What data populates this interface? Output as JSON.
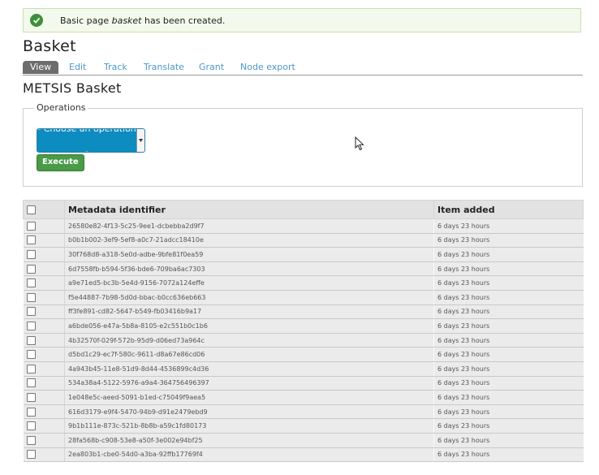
{
  "status": {
    "prefix": "Basic page ",
    "item": "basket",
    "suffix": " has been created."
  },
  "page_title": "Basket",
  "tabs": [
    {
      "label": "View",
      "active": true
    },
    {
      "label": "Edit"
    },
    {
      "label": "Track"
    },
    {
      "label": "Translate"
    },
    {
      "label": "Grant"
    },
    {
      "label": "Node export"
    }
  ],
  "subtitle": "METSIS Basket",
  "operations": {
    "legend": "Operations",
    "select_value": "- Choose an operation -",
    "execute_label": "Execute"
  },
  "table": {
    "columns": [
      "Metadata identifier",
      "Item added"
    ],
    "rows": [
      {
        "id": "26580e82-4f13-5c25-9ee1-dcbebba2d9f7",
        "added": "6 days 23 hours"
      },
      {
        "id": "b0b1b002-3ef9-5ef8-a0c7-21adcc18410e",
        "added": "6 days 23 hours"
      },
      {
        "id": "30f768d8-a318-5e0d-adbe-9bfe81f0ea59",
        "added": "6 days 23 hours"
      },
      {
        "id": "6d7558fb-b594-5f36-bde6-709ba6ac7303",
        "added": "6 days 23 hours"
      },
      {
        "id": "a9e71ed5-bc3b-5e4d-9156-7072a124effe",
        "added": "6 days 23 hours"
      },
      {
        "id": "f5e44887-7b98-5d0d-bbac-b0cc636eb663",
        "added": "6 days 23 hours"
      },
      {
        "id": "ff3fe891-cd82-5647-b549-fb03416b9a17",
        "added": "6 days 23 hours"
      },
      {
        "id": "a6bde056-e47a-5b8a-8105-e2c551b0c1b6",
        "added": "6 days 23 hours"
      },
      {
        "id": "4b32570f-029f-572b-95d9-d06ed73a964c",
        "added": "6 days 23 hours"
      },
      {
        "id": "d5bd1c29-ec7f-580c-9611-d8a67e86cd06",
        "added": "6 days 23 hours"
      },
      {
        "id": "4a943b45-11e8-51d9-8d44-4536899c4d36",
        "added": "6 days 23 hours"
      },
      {
        "id": "534a38a4-5122-5976-a9a4-364756496397",
        "added": "6 days 23 hours"
      },
      {
        "id": "1e048e5c-aeed-5091-b1ed-c75049f9aea5",
        "added": "6 days 23 hours"
      },
      {
        "id": "616d3179-e9f4-5470-94b9-d91e2479ebd9",
        "added": "6 days 23 hours"
      },
      {
        "id": "9b1b111e-873c-521b-8b8b-a59c1fd80173",
        "added": "6 days 23 hours"
      },
      {
        "id": "28fa568b-c908-53e8-a50f-3e002e94bf25",
        "added": "6 days 23 hours"
      },
      {
        "id": "2ea803b1-cbe0-54d0-a3ba-92ffb17769f4",
        "added": "6 days 23 hours"
      }
    ]
  }
}
